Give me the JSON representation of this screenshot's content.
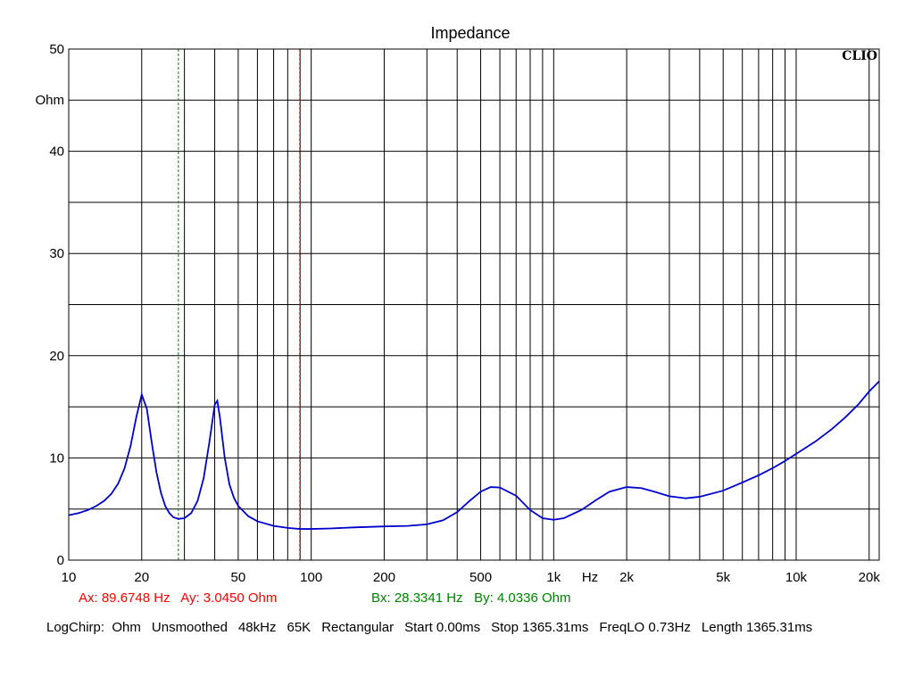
{
  "chart_data": {
    "type": "line",
    "title": "Impedance",
    "brand": "CLIO",
    "ylabel": "Ohm",
    "xlabel": "Hz",
    "x_scale": "log",
    "xlim": [
      10,
      22000
    ],
    "ylim": [
      0,
      50
    ],
    "y_ticks": [
      0,
      10,
      20,
      30,
      40,
      50
    ],
    "y_minor_ticks": [
      5,
      15,
      25,
      35,
      45
    ],
    "x_tick_labels": [
      {
        "x": 10,
        "label": "10"
      },
      {
        "x": 20,
        "label": "20"
      },
      {
        "x": 50,
        "label": "50"
      },
      {
        "x": 100,
        "label": "100"
      },
      {
        "x": 200,
        "label": "200"
      },
      {
        "x": 500,
        "label": "500"
      },
      {
        "x": 1000,
        "label": "1k"
      },
      {
        "x": 2000,
        "label": "2k"
      },
      {
        "x": 5000,
        "label": "5k"
      },
      {
        "x": 10000,
        "label": "10k"
      },
      {
        "x": 20000,
        "label": "20k"
      }
    ],
    "grid": true,
    "series": [
      {
        "color": "#0000cc",
        "points": [
          [
            10,
            4.4
          ],
          [
            11,
            4.6
          ],
          [
            12,
            4.9
          ],
          [
            13,
            5.3
          ],
          [
            14,
            5.8
          ],
          [
            15,
            6.5
          ],
          [
            16,
            7.5
          ],
          [
            17,
            9.0
          ],
          [
            18,
            11.2
          ],
          [
            19,
            14.0
          ],
          [
            20,
            16.2
          ],
          [
            21,
            14.8
          ],
          [
            22,
            11.5
          ],
          [
            23,
            8.6
          ],
          [
            24,
            6.6
          ],
          [
            25,
            5.3
          ],
          [
            26,
            4.6
          ],
          [
            27,
            4.2
          ],
          [
            28.3,
            4.03
          ],
          [
            30,
            4.1
          ],
          [
            32,
            4.6
          ],
          [
            34,
            5.8
          ],
          [
            36,
            8.0
          ],
          [
            38,
            11.5
          ],
          [
            40,
            15.2
          ],
          [
            41,
            15.6
          ],
          [
            42,
            14.0
          ],
          [
            44,
            10.0
          ],
          [
            46,
            7.4
          ],
          [
            48,
            6.1
          ],
          [
            50,
            5.3
          ],
          [
            55,
            4.3
          ],
          [
            60,
            3.8
          ],
          [
            70,
            3.35
          ],
          [
            80,
            3.15
          ],
          [
            89.7,
            3.05
          ],
          [
            100,
            3.05
          ],
          [
            120,
            3.1
          ],
          [
            150,
            3.2
          ],
          [
            200,
            3.3
          ],
          [
            250,
            3.35
          ],
          [
            300,
            3.5
          ],
          [
            350,
            3.9
          ],
          [
            400,
            4.7
          ],
          [
            450,
            5.8
          ],
          [
            500,
            6.7
          ],
          [
            550,
            7.15
          ],
          [
            600,
            7.1
          ],
          [
            700,
            6.3
          ],
          [
            800,
            4.9
          ],
          [
            900,
            4.1
          ],
          [
            1000,
            3.95
          ],
          [
            1100,
            4.1
          ],
          [
            1300,
            4.9
          ],
          [
            1500,
            5.9
          ],
          [
            1700,
            6.7
          ],
          [
            2000,
            7.15
          ],
          [
            2300,
            7.05
          ],
          [
            2600,
            6.7
          ],
          [
            3000,
            6.25
          ],
          [
            3500,
            6.05
          ],
          [
            4000,
            6.2
          ],
          [
            5000,
            6.8
          ],
          [
            6000,
            7.6
          ],
          [
            7000,
            8.3
          ],
          [
            8000,
            9.0
          ],
          [
            9000,
            9.7
          ],
          [
            10000,
            10.4
          ],
          [
            12000,
            11.6
          ],
          [
            14000,
            12.8
          ],
          [
            16000,
            14.0
          ],
          [
            18000,
            15.2
          ],
          [
            20000,
            16.5
          ],
          [
            22000,
            17.5
          ]
        ]
      }
    ],
    "cursors": [
      {
        "name": "A",
        "x": 89.6748,
        "color": "#ff0000"
      },
      {
        "name": "B",
        "x": 28.3341,
        "color": "#008000"
      }
    ],
    "cursor_readouts": [
      {
        "text": "Ax: 89.6748 Hz   Ay: 3.0450 Ohm",
        "color": "#ff0000"
      },
      {
        "text": "Bx: 28.3341 Hz   By: 4.0336 Ohm",
        "color": "#008000"
      }
    ]
  },
  "footer": {
    "items": [
      "LogChirp:  Ohm",
      "Unsmoothed",
      "48kHz",
      "65K",
      "Rectangular",
      "Start 0.00ms",
      "Stop 1365.31ms",
      "FreqLO 0.73Hz",
      "Length 1365.31ms"
    ]
  }
}
